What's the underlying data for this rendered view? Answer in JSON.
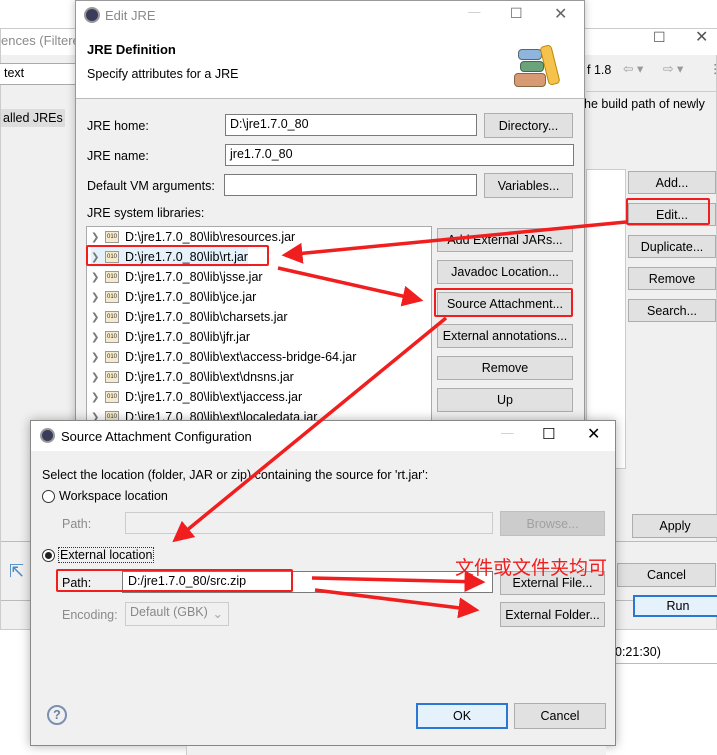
{
  "background_window": {
    "title_partial": "ences (Filtered",
    "filter_value": "text",
    "selected_item": "alled JREs",
    "compliance_partial": "f 1.8",
    "description_partial": "he build path of newly",
    "buttons": {
      "add": "Add...",
      "edit": "Edit...",
      "duplicate": "Duplicate...",
      "remove": "Remove",
      "search": "Search...",
      "apply": "Apply",
      "cancel": "Cancel",
      "run": "Run"
    },
    "console_time_partial": "0:21:30)"
  },
  "edit_jre": {
    "title": "Edit JRE",
    "header_title": "JRE Definition",
    "header_subtitle": "Specify attributes for a JRE",
    "jre_home_label": "JRE home:",
    "jre_home_value": "D:\\jre1.7.0_80",
    "directory_button": "Directory...",
    "jre_name_label": "JRE name:",
    "jre_name_value": "jre1.7.0_80",
    "vm_args_label": "Default VM arguments:",
    "vm_args_value": "",
    "variables_button": "Variables...",
    "libraries_label": "JRE system libraries:",
    "libraries": [
      "D:\\jre1.7.0_80\\lib\\resources.jar",
      "D:\\jre1.7.0_80\\lib\\rt.jar",
      "D:\\jre1.7.0_80\\lib\\jsse.jar",
      "D:\\jre1.7.0_80\\lib\\jce.jar",
      "D:\\jre1.7.0_80\\lib\\charsets.jar",
      "D:\\jre1.7.0_80\\lib\\jfr.jar",
      "D:\\jre1.7.0_80\\lib\\ext\\access-bridge-64.jar",
      "D:\\jre1.7.0_80\\lib\\ext\\dnsns.jar",
      "D:\\jre1.7.0_80\\lib\\ext\\jaccess.jar",
      "D:\\jre1.7.0_80\\lib\\ext\\localedata.jar"
    ],
    "jar_icon_text": "010",
    "buttons": {
      "add_external_jars": "Add External JARs...",
      "javadoc_location": "Javadoc Location...",
      "source_attachment": "Source Attachment...",
      "external_annotations": "External annotations...",
      "remove": "Remove",
      "up": "Up"
    }
  },
  "source_attachment": {
    "title": "Source Attachment Configuration",
    "instruction": "Select the location (folder, JAR or zip) containing the source for 'rt.jar':",
    "workspace_location": "Workspace location",
    "workspace_path_label": "Path:",
    "workspace_path_value": "",
    "browse_button": "Browse...",
    "external_location": "External location",
    "selected_option": "External location",
    "external_path_label": "Path:",
    "external_path_value": "D:/jre1.7.0_80/src.zip",
    "external_file_button": "External File...",
    "encoding_label": "Encoding:",
    "encoding_value": "Default (GBK)",
    "external_folder_button": "External Folder...",
    "ok_button": "OK",
    "cancel_button": "Cancel"
  },
  "annotation": {
    "text": "文件或文件夹均可",
    "color": "#f01e1e"
  }
}
